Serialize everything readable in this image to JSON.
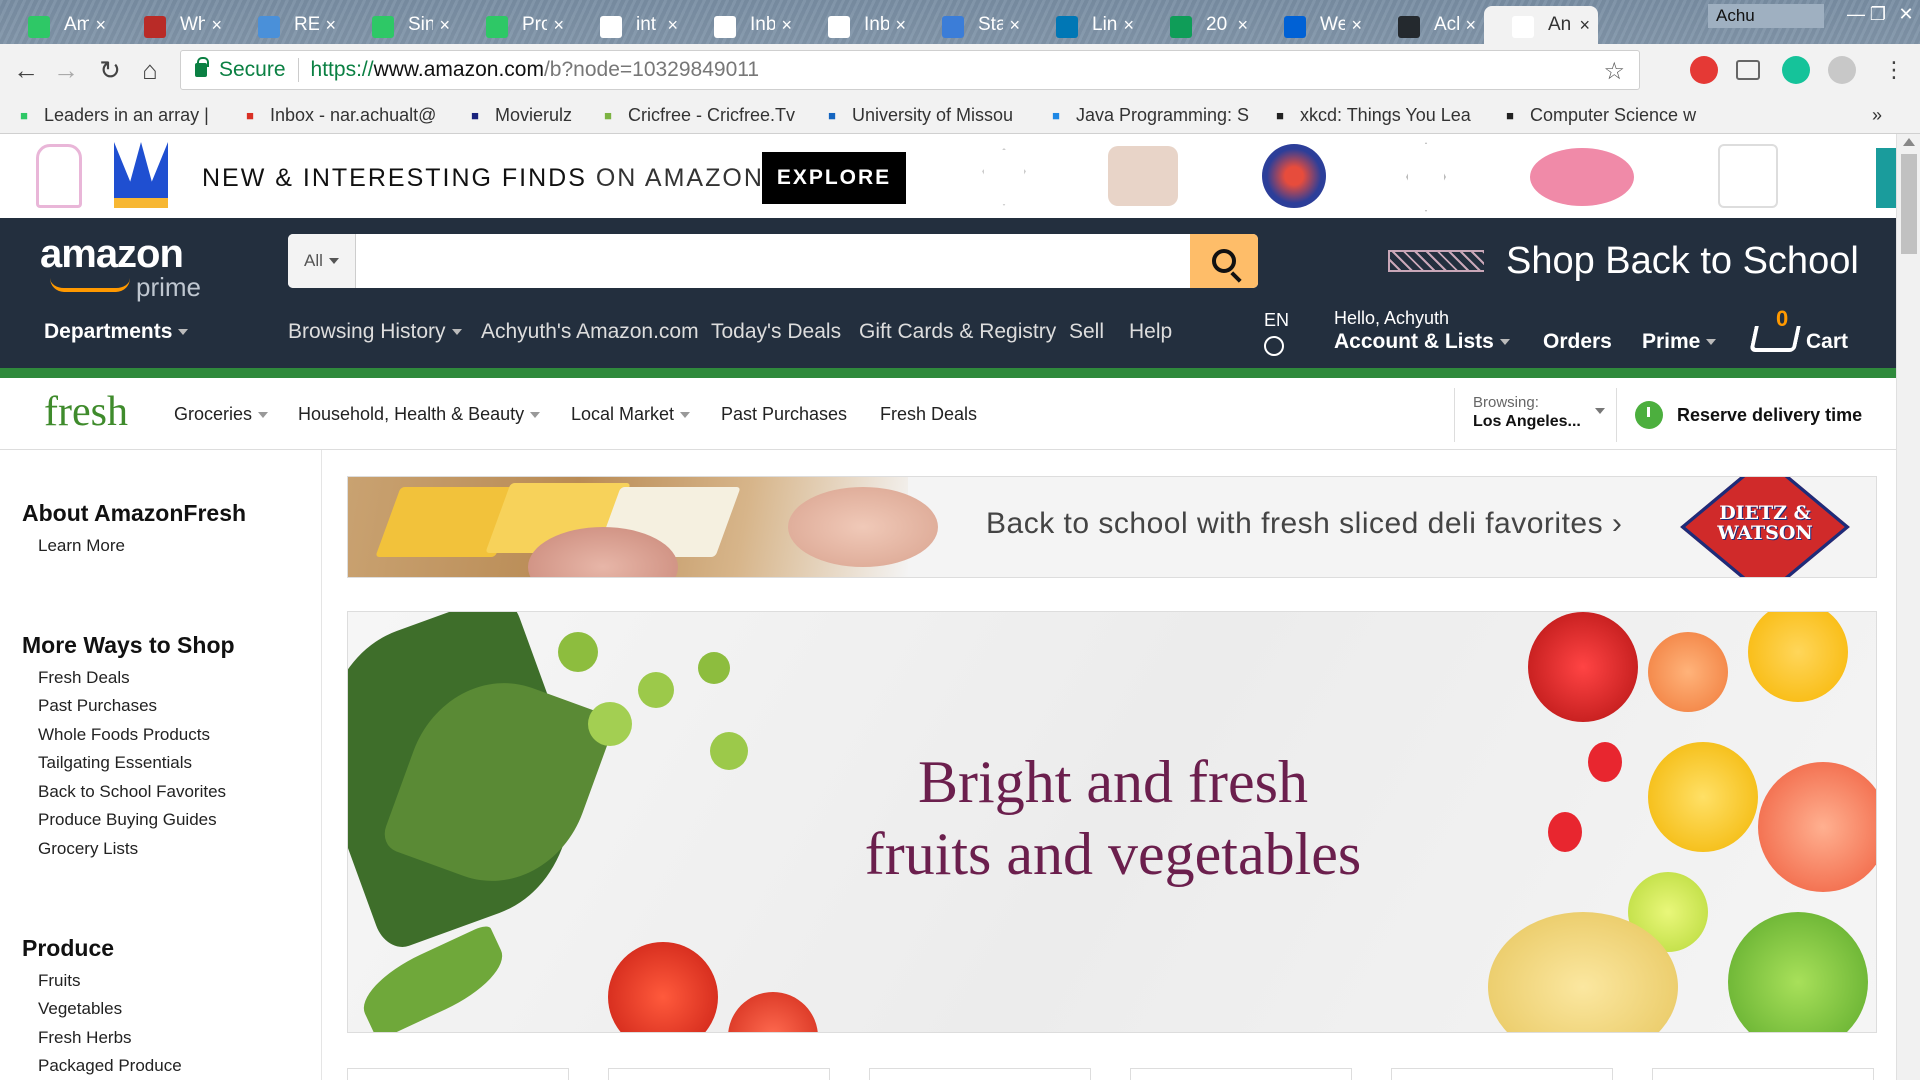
{
  "browser": {
    "tabs": [
      {
        "title": "Am",
        "icon": "hackerrank-icon",
        "color": "#2ec866"
      },
      {
        "title": "Wh",
        "icon": "quora-icon",
        "color": "#b92b27"
      },
      {
        "title": "RE",
        "icon": "interviewbit-icon",
        "color": "#4a90d9"
      },
      {
        "title": "Sin",
        "icon": "hackerearth-icon",
        "color": "#2ec866"
      },
      {
        "title": "Pro",
        "icon": "hackerrank-icon",
        "color": "#2ec866"
      },
      {
        "title": "int",
        "icon": "google-icon",
        "color": "#ffffff"
      },
      {
        "title": "Inb",
        "icon": "gmail-icon",
        "color": "#ffffff"
      },
      {
        "title": "Inb",
        "icon": "gmail-icon",
        "color": "#ffffff"
      },
      {
        "title": "Sta",
        "icon": "stackoverflow-icon",
        "color": "#3b7dd8"
      },
      {
        "title": "Lin",
        "icon": "linkedin-icon",
        "color": "#0077b5"
      },
      {
        "title": "20",
        "icon": "sheets-icon",
        "color": "#0f9d58"
      },
      {
        "title": "We",
        "icon": "box-icon",
        "color": "#0061d5"
      },
      {
        "title": "Acl",
        "icon": "github-icon",
        "color": "#24292e"
      },
      {
        "title": "An",
        "icon": "amazon-icon",
        "color": "#ffffff"
      }
    ],
    "user": "Achu",
    "url_secure": "Secure",
    "url_scheme": "https://",
    "url_host": "www.amazon.com",
    "url_path": "/b?node=10329849011",
    "bookmarks": [
      {
        "label": "Leaders in an array |",
        "icon": "hackerrank-icon"
      },
      {
        "label": "Inbox - nar.achualt@",
        "icon": "gmail-icon"
      },
      {
        "label": "Movierulz",
        "icon": "movierulz-icon"
      },
      {
        "label": "Cricfree - Cricfree.Tv",
        "icon": "cricfree-icon"
      },
      {
        "label": "University of Missou",
        "icon": "university-icon"
      },
      {
        "label": "Java Programming: S",
        "icon": "coursera-icon"
      },
      {
        "label": "xkcd: Things You Lea",
        "icon": "xkcd-icon"
      },
      {
        "label": "Computer Science w",
        "icon": "grad-cap-icon"
      }
    ],
    "bookmarks_more": "»"
  },
  "promo": {
    "text_bold": "NEW & INTERESTING FINDS",
    "text_rest": "ON AMAZON",
    "explore_label": "EXPLORE"
  },
  "header": {
    "logo_word": "amazon",
    "logo_prime": "prime",
    "search_category": "All",
    "search_placeholder": "",
    "school_banner": "Shop Back to School",
    "nav": {
      "departments": "Departments",
      "browsing_history": "Browsing History",
      "my_amazon": "Achyuth's Amazon.com",
      "todays_deals": "Today's Deals",
      "gift_cards": "Gift Cards & Registry",
      "sell": "Sell",
      "help": "Help"
    },
    "lang": "EN",
    "hello": "Hello, Achyuth",
    "account": "Account & Lists",
    "orders": "Orders",
    "prime": "Prime",
    "cart_count": "0",
    "cart": "Cart"
  },
  "fresh_nav": {
    "logo": "fresh",
    "links": [
      "Groceries",
      "Household, Health & Beauty",
      "Local Market",
      "Past Purchases",
      "Fresh Deals"
    ],
    "browsing_label": "Browsing:",
    "browsing_value": "Los Angeles...",
    "reserve": "Reserve delivery time"
  },
  "sidebar": {
    "about_head": "About AmazonFresh",
    "about_links": [
      "Learn More"
    ],
    "more_head": "More Ways to Shop",
    "more_links": [
      "Fresh Deals",
      "Past Purchases",
      "Whole Foods Products",
      "Tailgating Essentials",
      "Back to School Favorites",
      "Produce Buying Guides",
      "Grocery Lists"
    ],
    "produce_head": "Produce",
    "produce_links": [
      "Fruits",
      "Vegetables",
      "Fresh Herbs",
      "Packaged Produce"
    ]
  },
  "banners": {
    "deli_text": "Back to school with fresh sliced deli favorites ›",
    "deli_brand": "DIETZ & WATSON",
    "hero_line1": "Bright and fresh",
    "hero_line2": "fruits and vegetables"
  },
  "colors": {
    "amazon_nav": "#232f3e",
    "fresh_green": "#3f8b2c",
    "search_button": "#febd69",
    "hero_text": "#6b1f4d"
  }
}
